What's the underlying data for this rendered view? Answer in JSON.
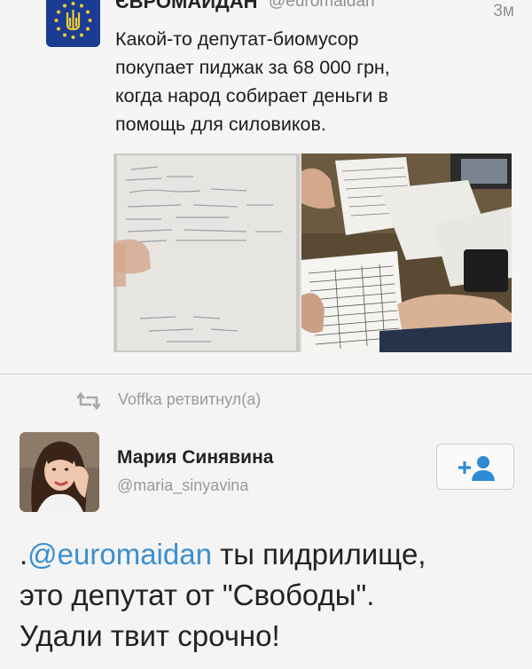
{
  "tweet1": {
    "author_name": "ЄВРОМАЙДАН",
    "author_handle": "@euromaidan",
    "time": "3м",
    "text_lines": [
      "Какой-то депутат-биомусор",
      "покупает пиджак за 68 000 грн,",
      "когда народ собирает деньги в",
      "помощь для силовиков."
    ],
    "avatar_icon": "trident-eu-flag-icon",
    "photo_icon": "receipt-photo-icon"
  },
  "retweet": {
    "icon": "retweet-icon",
    "text": "Voffka ретвитнул(а)"
  },
  "tweet2": {
    "author_name": "Мария Синявина",
    "author_handle": "@maria_sinyavina",
    "avatar_icon": "profile-photo-icon",
    "follow_icon": "add-user-icon",
    "mention": "@euromaidan",
    "text_prefix": ".",
    "text_after_mention": " ты пидрилище,",
    "text_line2": "это депутат от \"Свободы\".",
    "text_line3": "Удали твит срочно!"
  },
  "colors": {
    "link": "#3b8fd1",
    "muted": "#999999",
    "eu_blue": "#1a3c93",
    "eu_gold": "#f2cd2e"
  }
}
